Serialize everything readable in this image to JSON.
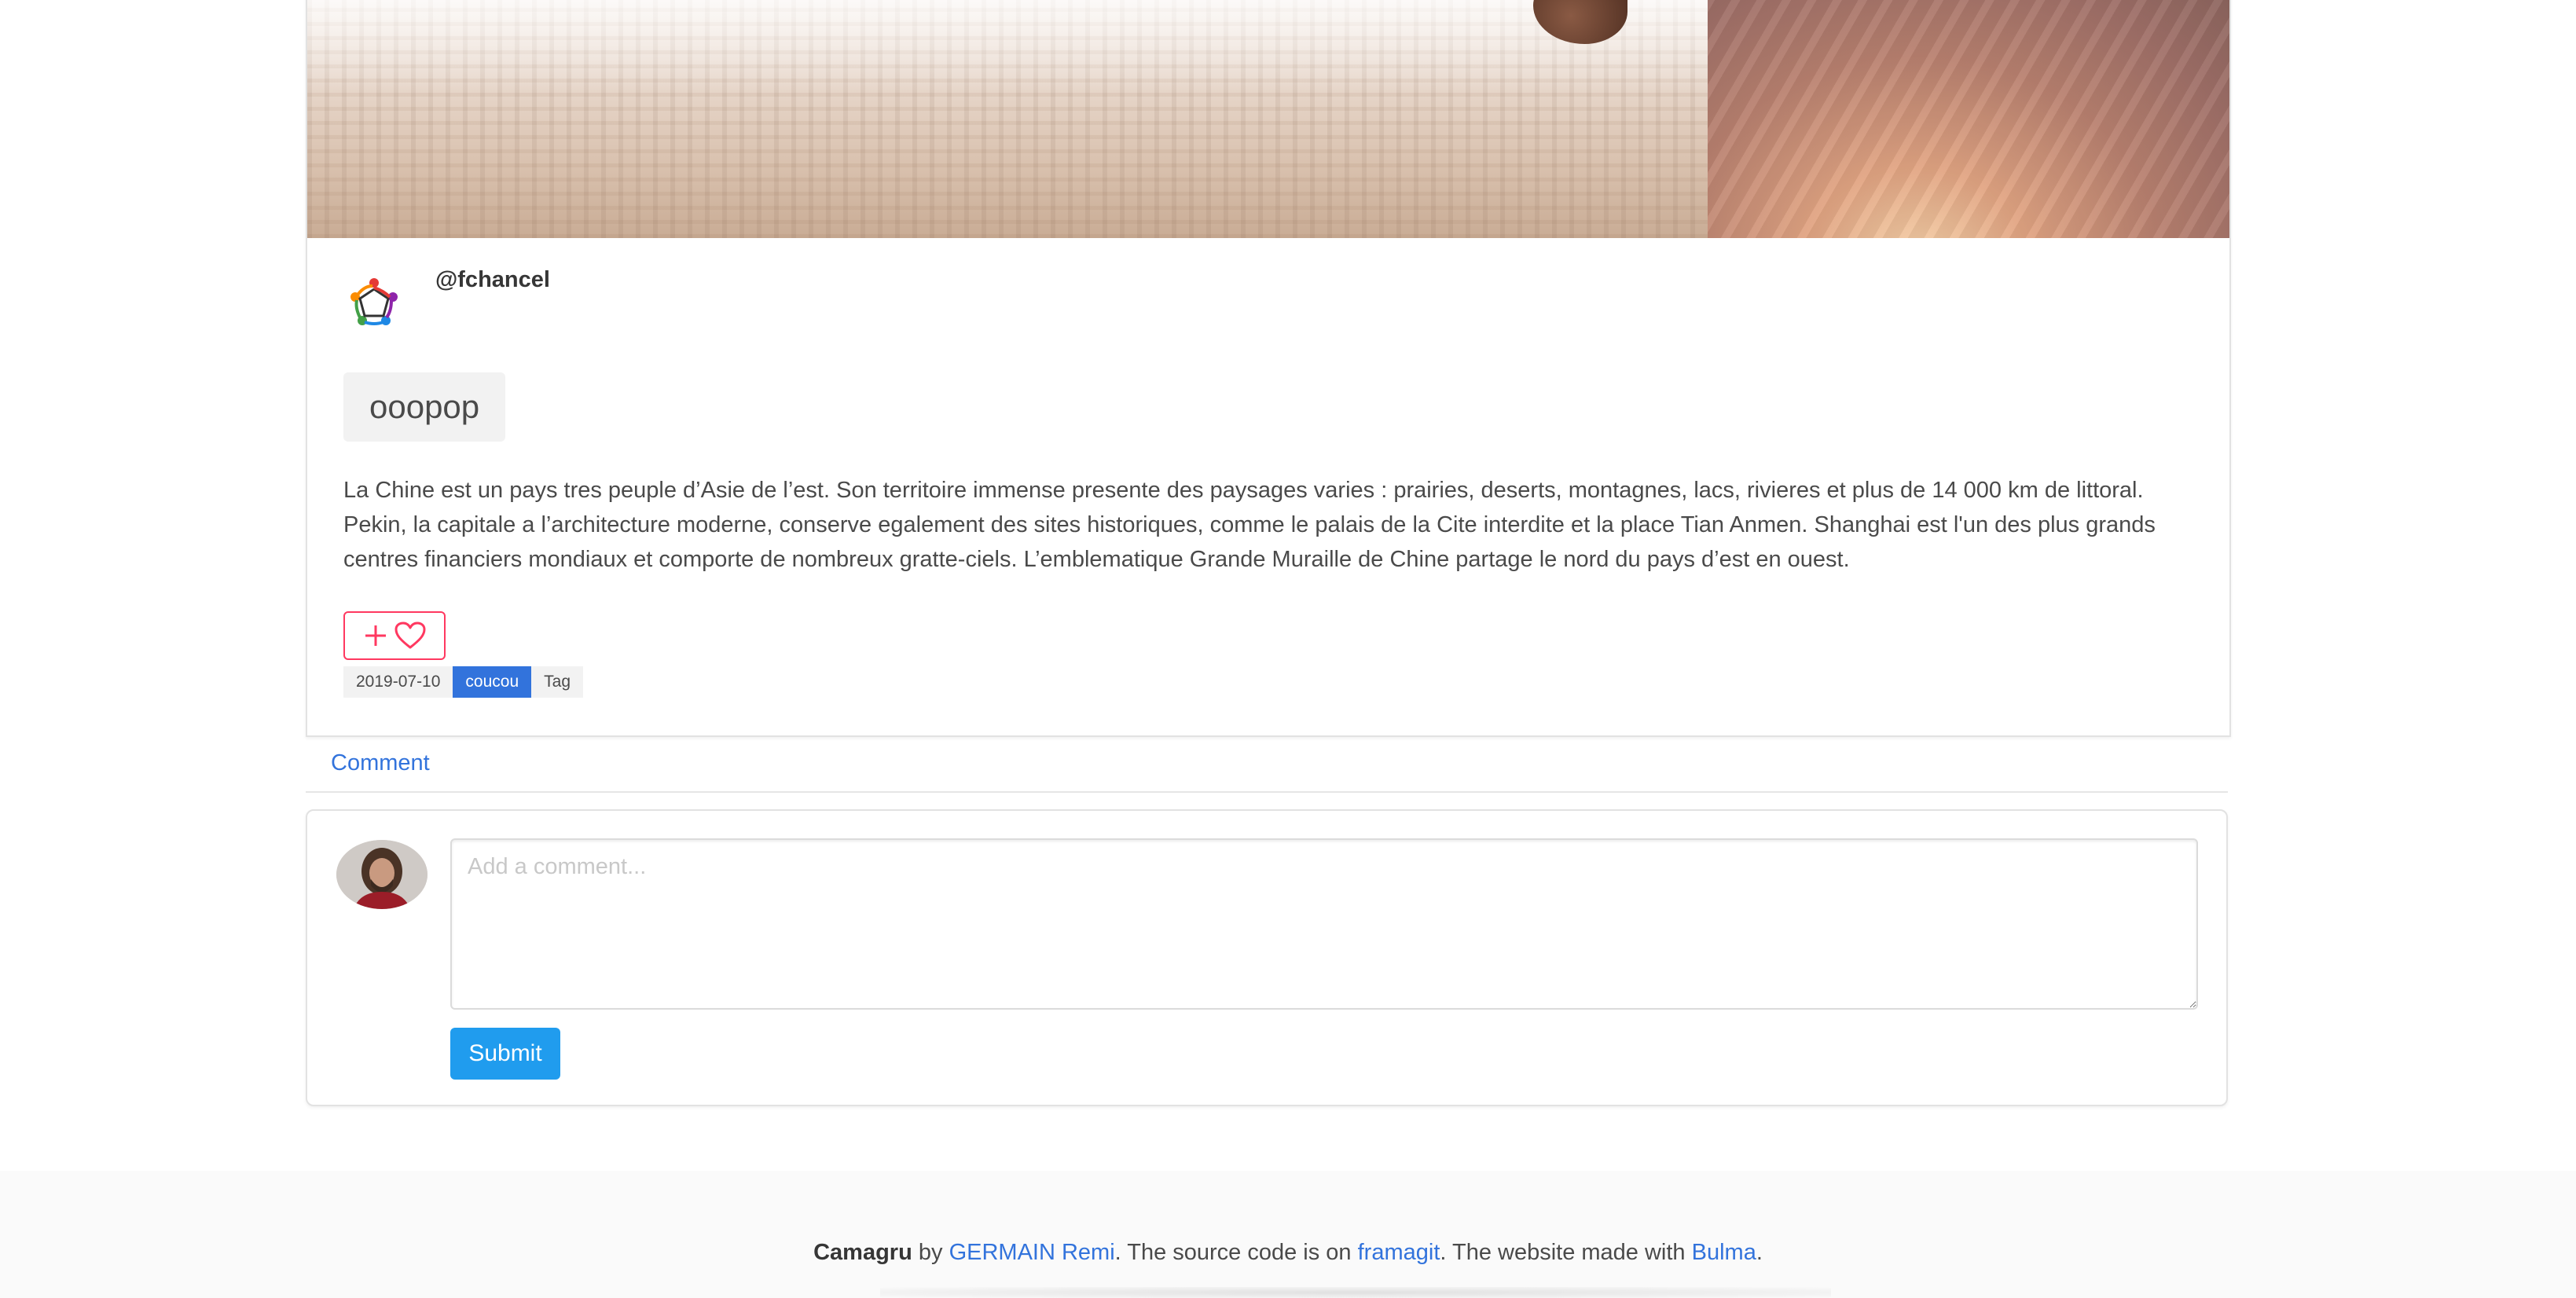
{
  "post": {
    "username": "@fchancel",
    "title": "ooopop",
    "body": "La Chine est un pays tres peuple d’Asie de l’est. Son territoire immense presente des paysages varies : prairies, deserts, montagnes, lacs, rivieres et plus de 14 000 km de littoral. Pekin, la capitale a l’architecture moderne, conserve egalement des sites historiques, comme le palais de la Cite interdite et la place Tian Anmen. Shanghai est l'un des plus grands centres financiers mondiaux et comporte de nombreux gratte-ciels. L’emblematique Grande Muraille de Chine partage le nord du pays d’est en ouest.",
    "like_button": {
      "plus_icon": "plus-icon",
      "heart_icon": "heart-icon",
      "color": "#ff3860"
    },
    "date": "2019-07-10",
    "tags": [
      "coucou",
      "Tag"
    ]
  },
  "comments": {
    "tab_label": "Comment",
    "input_placeholder": "Add a comment...",
    "submit_label": "Submit"
  },
  "footer": {
    "brand": "Camagru",
    "by": " by ",
    "author": "GERMAIN Remi",
    "source_text": ". The source code is on ",
    "source_link": "framagit",
    "made_text": ". The website made with ",
    "framework_link": "Bulma",
    "end": "."
  },
  "colors": {
    "link": "#3273dc",
    "primary_button": "#209cee",
    "tag_blue": "#3273dc",
    "danger": "#ff3860"
  }
}
